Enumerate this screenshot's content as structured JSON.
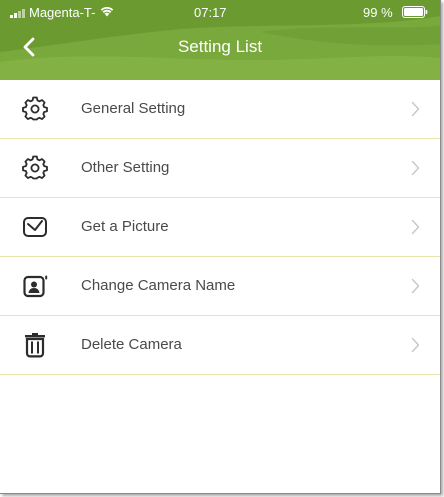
{
  "status_bar": {
    "carrier": "Magenta-T-",
    "time": "07:17",
    "battery_percent": "99 %"
  },
  "nav": {
    "title": "Setting List",
    "back_icon": "back-chevron-icon"
  },
  "settings": {
    "items": [
      {
        "label": "General Setting",
        "icon": "gear-icon"
      },
      {
        "label": "Other Setting",
        "icon": "gear-icon"
      },
      {
        "label": "Get a Picture",
        "icon": "envelope-icon"
      },
      {
        "label": "Change Camera Name",
        "icon": "contact-card-icon"
      },
      {
        "label": "Delete Camera",
        "icon": "trash-icon"
      }
    ]
  },
  "colors": {
    "header_green": "#79a83c",
    "header_dark_green": "#5f8f2a",
    "divider": "#e9e3b0",
    "label_text": "#4a4a4a",
    "icon": "#2c2c2c",
    "chevron": "#c8c8c8"
  }
}
